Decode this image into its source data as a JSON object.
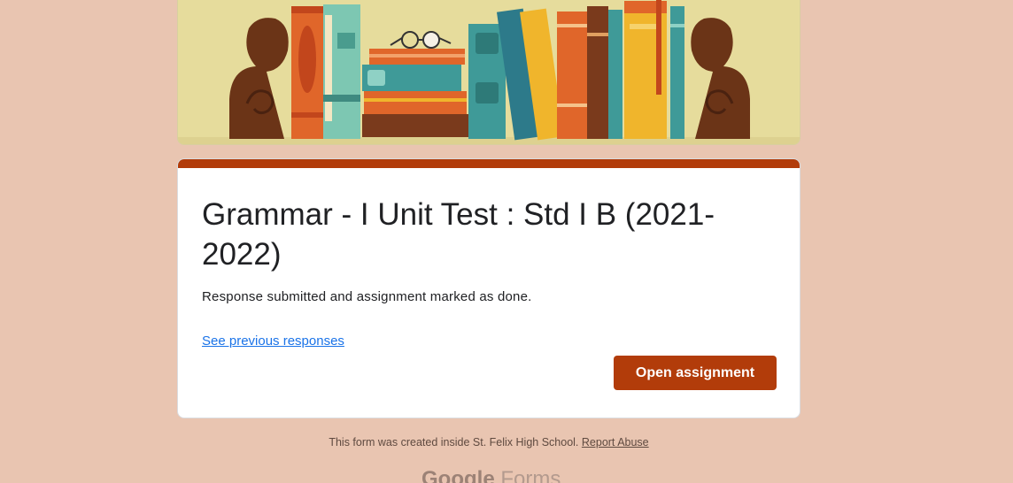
{
  "banner": {
    "image_name": "bookshelf-illustration",
    "colors": {
      "background": "#e6dc9c",
      "bookend": "#6b3417",
      "teal": "#3f9a98",
      "orange": "#e0662a",
      "yellow": "#f0b52c",
      "red": "#c2461c",
      "dark_brown": "#7a3a1c"
    }
  },
  "card": {
    "title": "Grammar - I Unit Test : Std I B (2021-2022)",
    "message": "Response submitted and assignment marked as done.",
    "previous_link": "See previous responses",
    "open_button": "Open assignment",
    "accent_color": "#b23c0a"
  },
  "footer": {
    "created_text": "This form was created inside St. Felix High School.",
    "report_link": "Report Abuse",
    "brand_google": "Google",
    "brand_forms": "Forms"
  },
  "theme": {
    "page_background": "#e9c5b1",
    "button_color": "#b23c0a",
    "link_color": "#1a73e8"
  }
}
